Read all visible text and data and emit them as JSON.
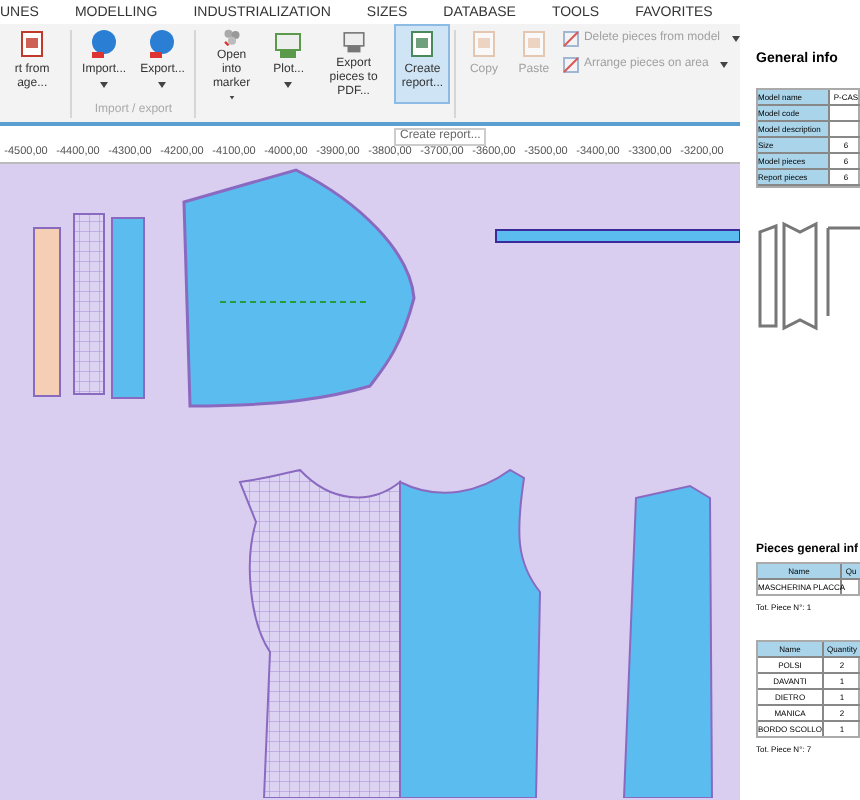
{
  "menu_tabs": [
    {
      "label": "UNES"
    },
    {
      "label": "MODELLING"
    },
    {
      "label": "INDUSTRIALIZATION"
    },
    {
      "label": "SIZES"
    },
    {
      "label": "DATABASE"
    },
    {
      "label": "TOOLS"
    },
    {
      "label": "FAVORITES"
    }
  ],
  "ribbon": {
    "groups": [
      {
        "buttons": [
          {
            "kind": "large",
            "label": "rt from age...",
            "dropdown": false,
            "disabled": false,
            "selected": false
          }
        ]
      },
      {
        "label": "Import / export",
        "buttons": [
          {
            "kind": "large",
            "label": "Import...",
            "dropdown": true,
            "disabled": false,
            "selected": false
          },
          {
            "kind": "large",
            "label": "Export...",
            "dropdown": true,
            "disabled": false,
            "selected": false
          }
        ]
      },
      {
        "buttons": [
          {
            "kind": "large",
            "label": "Open into marker",
            "dropdown": true,
            "disabled": false,
            "selected": false
          },
          {
            "kind": "large",
            "label": "Plot...",
            "dropdown": true,
            "disabled": false,
            "selected": false
          },
          {
            "kind": "large",
            "label": "Export pieces to PDF...",
            "dropdown": false,
            "disabled": false,
            "selected": false
          },
          {
            "kind": "large",
            "label": "Create report...",
            "dropdown": false,
            "disabled": false,
            "selected": true
          }
        ]
      },
      {
        "buttons": [
          {
            "kind": "large",
            "label": "Copy",
            "dropdown": false,
            "disabled": true,
            "selected": false
          },
          {
            "kind": "large",
            "label": "Paste",
            "dropdown": false,
            "disabled": true,
            "selected": false
          },
          {
            "kind": "small",
            "label": "Delete pieces from model",
            "dropdown": true,
            "disabled": true,
            "selected": false
          },
          {
            "kind": "small",
            "label": "Arrange pieces on area",
            "dropdown": true,
            "disabled": true,
            "selected": false
          }
        ]
      }
    ]
  },
  "tooltip": "Create report...",
  "ruler": {
    "labels": [
      "-4500,00",
      "-4400,00",
      "-4300,00",
      "-4200,00",
      "-4100,00",
      "-4000,00",
      "-3900,00",
      "-3800,00",
      "-3700,00",
      "-3600,00",
      "-3500,00",
      "-3400,00",
      "-3300,00",
      "-3200,00"
    ]
  },
  "report": {
    "title": "General info",
    "general_rows": [
      {
        "label": "Model name",
        "value": "P-CAS"
      },
      {
        "label": "Model code"
      },
      {
        "label": "Model description"
      },
      {
        "label": "Size",
        "value": "6"
      },
      {
        "label": "Model pieces",
        "value": "6"
      },
      {
        "label": "Report pieces",
        "value": "6"
      }
    ],
    "pieces_title": "Pieces general inf",
    "tables": [
      {
        "columns": [
          "Name",
          "Qu"
        ],
        "rows": [
          [
            "MASCHERINA PLACCA"
          ]
        ],
        "total": "Tot. Piece N°: 1"
      },
      {
        "columns": [
          "Name",
          "Quantity"
        ],
        "rows": [
          [
            "POLSI",
            "2"
          ],
          [
            "DAVANTI",
            "1"
          ],
          [
            "DIETRO",
            "1"
          ],
          [
            "MANICA",
            "2"
          ],
          [
            "BORDO SCOLLO",
            "1"
          ]
        ],
        "total": "Tot. Piece N°: 7"
      }
    ]
  }
}
